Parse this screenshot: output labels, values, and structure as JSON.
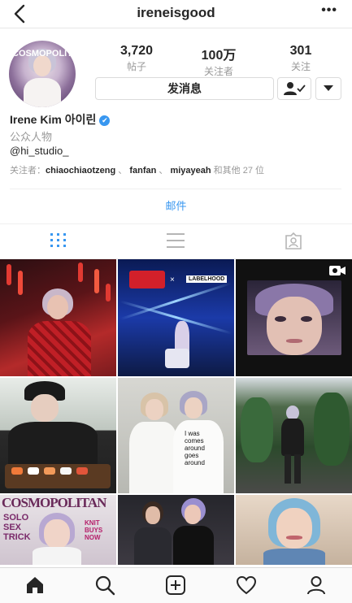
{
  "nav": {
    "title": "ireneisgood",
    "back_icon": "chevron-left-icon",
    "more_label": "•••"
  },
  "profile": {
    "avatar_text": "COSMOPOLITAN",
    "stats": [
      {
        "value": "3,720",
        "label": "帖子"
      },
      {
        "value": "100万",
        "label": "关注者"
      },
      {
        "value": "301",
        "label": "关注"
      }
    ],
    "message_button": "发消息",
    "name": "Irene Kim 아이린",
    "verified_icon": "✔",
    "category": "公众人物",
    "bio": "@hi_studio_",
    "followed_by": {
      "prefix": "关注者：",
      "users": [
        "chiaochiaotzeng",
        "fanfan",
        "miyayeah"
      ],
      "separator": " 、",
      "suffix": "和其他 27 位"
    },
    "email_label": "邮件"
  },
  "tabs": [
    {
      "icon": "grid-icon",
      "active": true
    },
    {
      "icon": "list-icon",
      "active": false
    },
    {
      "icon": "tagged-icon",
      "active": false
    }
  ],
  "posts": [
    {
      "name": "post-red-lanterns",
      "text": ""
    },
    {
      "name": "post-budweiser-stage",
      "text": "LABELHOOD"
    },
    {
      "name": "post-selfie-video",
      "text": ""
    },
    {
      "name": "post-sushi",
      "text": ""
    },
    {
      "name": "post-two-girls-shirts",
      "text": "I was comes around goes around"
    },
    {
      "name": "post-garden-walk",
      "text": ""
    },
    {
      "name": "post-cosmopolitan-cover",
      "text": "COSMOPOLITAN"
    },
    {
      "name": "post-with-friend",
      "text": ""
    },
    {
      "name": "post-blue-hair-smile",
      "text": ""
    }
  ],
  "cover_texts": {
    "solo": "SOLO",
    "sex": "SEX",
    "trick": "TRICK",
    "knit": "KNIT BUYS",
    "now": "NOW"
  },
  "bottom_nav": [
    "home-icon",
    "search-icon",
    "add-post-icon",
    "heart-icon",
    "profile-icon"
  ],
  "colors": {
    "accent": "#3897f0",
    "verified": "#3897f0"
  }
}
